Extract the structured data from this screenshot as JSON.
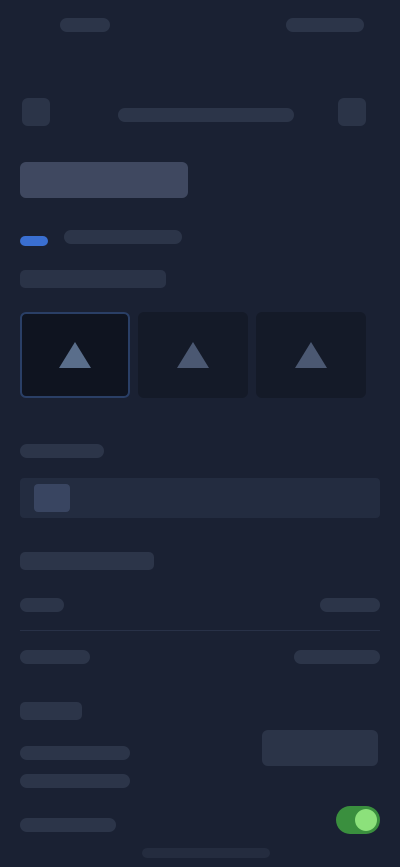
{
  "status_bar": {
    "time": "",
    "signal": ""
  },
  "top_bar": {
    "back_label": "",
    "subtitle": "",
    "more_label": ""
  },
  "page": {
    "title": "",
    "tag": "",
    "section_label": ""
  },
  "segmented": {
    "selected_label": "",
    "other_label": ""
  },
  "settings": {
    "row1_label": "",
    "row1_value": "",
    "row2_label": "",
    "row2_value": "",
    "toggle_label": "",
    "toggle_on": true,
    "action_label": ""
  },
  "footer": {
    "caption": ""
  }
}
